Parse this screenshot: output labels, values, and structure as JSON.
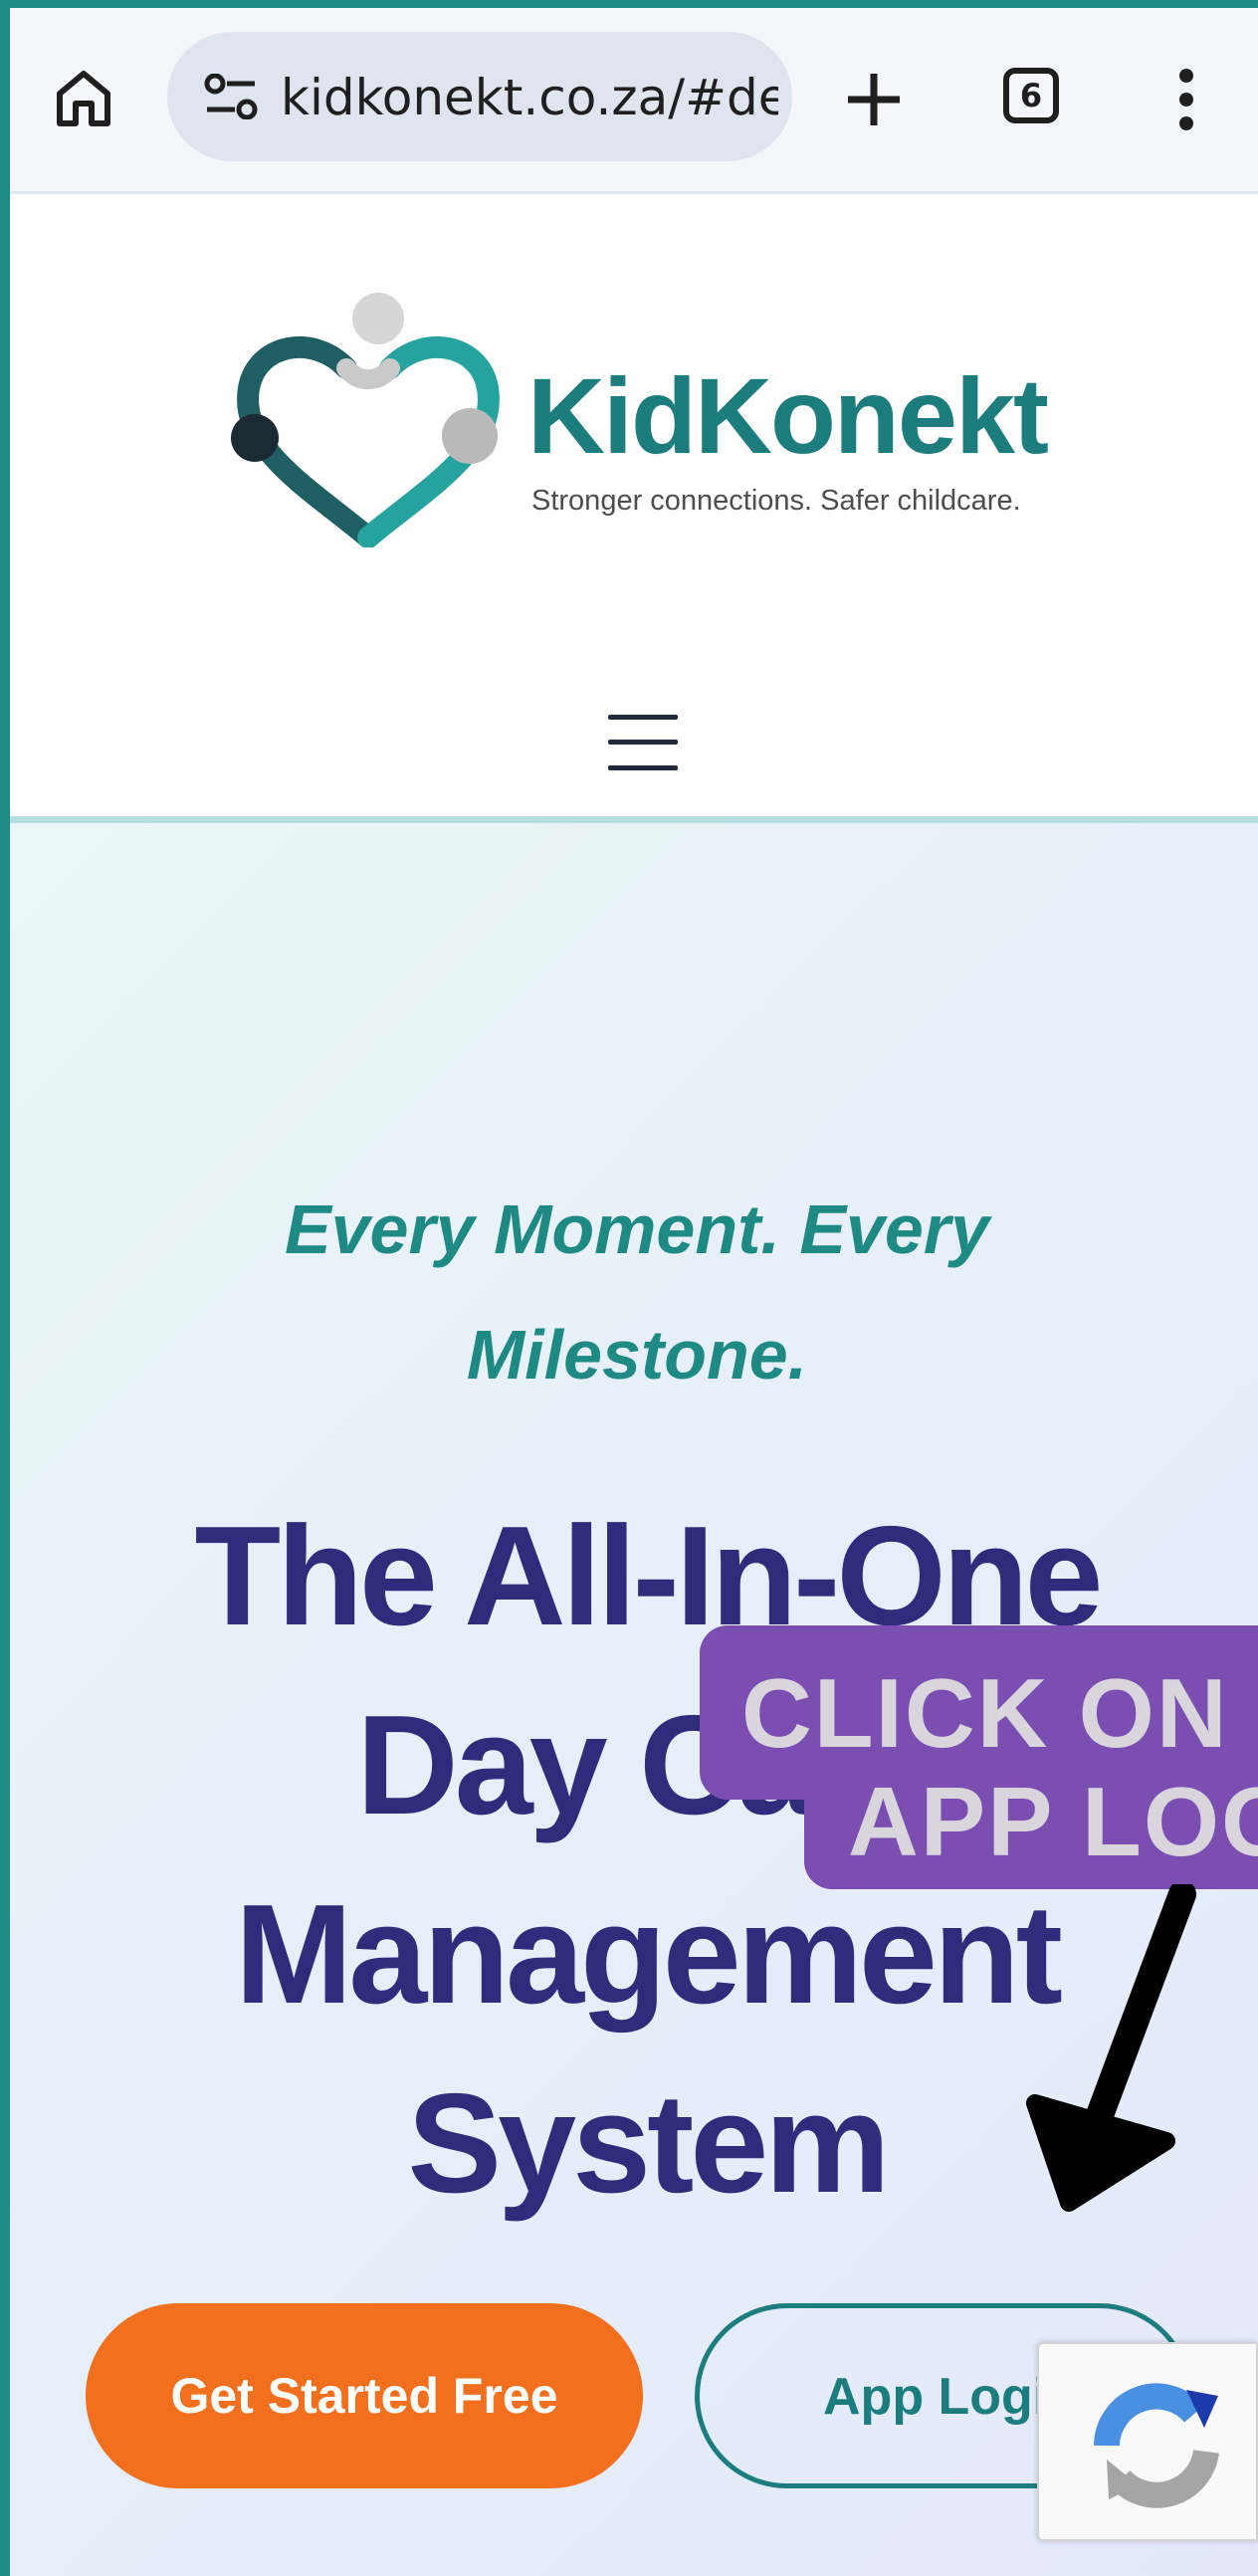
{
  "browser": {
    "url": "kidkonekt.co.za/#demo",
    "tab_count": "6",
    "icons": [
      "home-icon",
      "site-settings-icon",
      "plus-icon",
      "tabs-icon",
      "more-vertical-icon"
    ]
  },
  "header": {
    "brand_name": "KidKonekt",
    "brand_tagline": "Stronger connections. Safer childcare.",
    "menu_icon": "hamburger-menu-icon"
  },
  "hero": {
    "tagline": "Every Moment. Every Milestone.",
    "title": "The All-In-One Day Care Management System",
    "primary_cta": "Get Started Free",
    "secondary_cta": "App Login"
  },
  "overlay": {
    "callout_line1": "CLICK ON",
    "callout_line2": "APP LOGIN",
    "arrow_icon": "down-arrow-icon",
    "recaptcha_icon": "recaptcha-icon"
  },
  "colors": {
    "brand_teal": "#1d7c7e",
    "title_navy": "#2f2c7b",
    "cta_orange": "#f26f1d",
    "callout_purple": "#7b4fb2"
  }
}
